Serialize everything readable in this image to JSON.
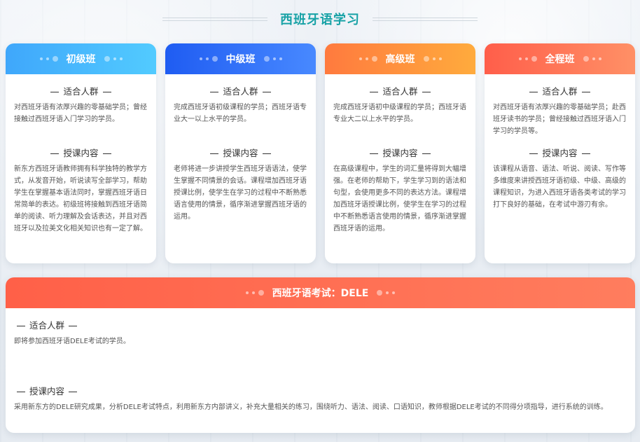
{
  "page": {
    "title": "西班牙语学习"
  },
  "courses": [
    {
      "name": "初级班",
      "audience_title": "适合人群",
      "audience": "对西班牙语有浓厚兴趣的零基础学员；曾经接触过西班牙语入门学习的学员。",
      "content_title": "授课内容",
      "content": "新东方西班牙语教师拥有科学独特的教学方式，从发音开始，听说读写全部学习，帮助学生在掌握基本语法同时，掌握西班牙语日常简单的表达。初级班将接触到西班牙语简单的阅读、听力理解及会话表达，并且对西班牙以及拉美文化相关知识也有一定了解。"
    },
    {
      "name": "中级班",
      "audience_title": "适合人群",
      "audience": "完成西班牙语初级课程的学员；西班牙语专业大一以上水平的学员。",
      "content_title": "授课内容",
      "content": "老师将进一步讲授学生西班牙语语法，使学生掌握不同情景的会话。课程增加西班牙语授课比例，使学生在学习的过程中不断熟悉语言使用的情景，循序渐进掌握西班牙语的运用。"
    },
    {
      "name": "高级班",
      "audience_title": "适合人群",
      "audience": "完成西班牙语初中级课程的学员；西班牙语专业大二以上水平的学员。",
      "content_title": "授课内容",
      "content": "在高级课程中，学生的词汇量将得到大幅增强。在老师的帮助下，学生学习到的语法和句型，会使用更多不同的表达方法。课程增加西班牙语授课比例，使学生在学习的过程中不断熟悉语言使用的情景，循序渐进掌握西班牙语的运用。"
    },
    {
      "name": "全程班",
      "audience_title": "适合人群",
      "audience": "对西班牙语有浓厚兴趣的零基础学员；赴西班牙读书的学员；曾经接触过西班牙语入门学习的学员等。",
      "content_title": "授课内容",
      "content": "该课程从语音、语法、听说、阅读、写作等多维度来讲授西班牙语初级、中级、高级的课程知识，为进入西班牙语各类考试的学习打下良好的基础，在考试中游刃有余。"
    }
  ],
  "dele": {
    "name": "西班牙语考试：DELE",
    "audience_title": "适合人群",
    "audience": "即将参加西班牙语DELE考试的学员。",
    "content_title": "授课内容",
    "content": "采用新东方的DELE研究成果，分析DELE考试特点，利用新东方内部讲义，补充大量相关的练习，围绕听力、语法、阅读、口语知识，教师根据DELE考试的不同得分项指导，进行系统的训练。"
  },
  "colors": {
    "title": "#18a2a6",
    "beginner": "#3fa7fb",
    "intermediate": "#1f5cf2",
    "advanced": "#ff7a3e",
    "full": "#ff5e4a",
    "dele": "#ff6048"
  }
}
